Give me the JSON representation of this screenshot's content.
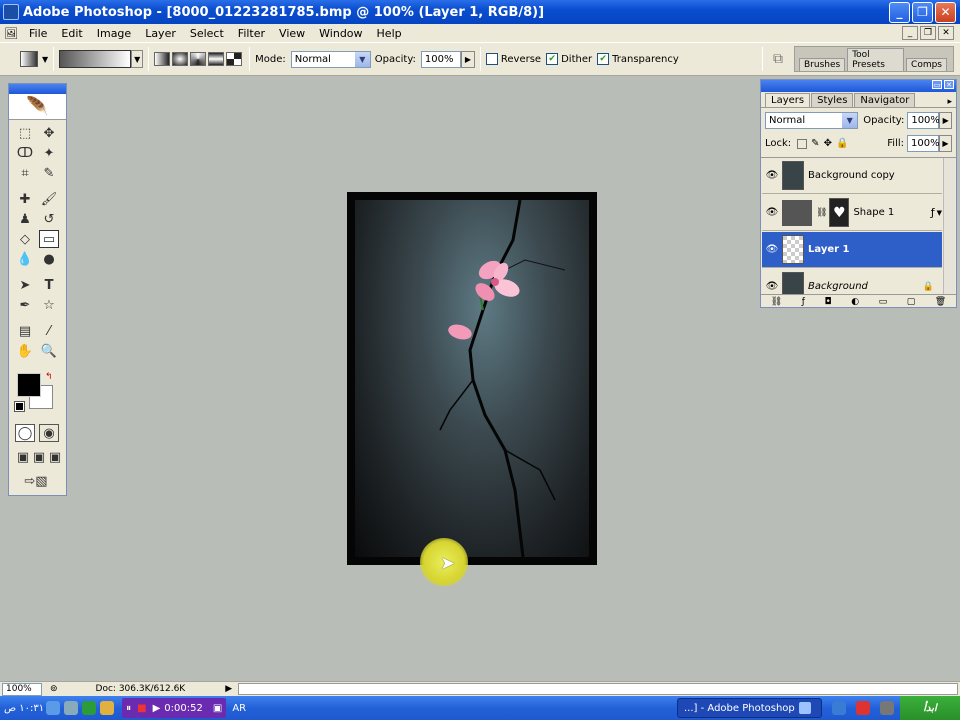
{
  "window": {
    "title": "Adobe Photoshop - [8000_01223281785.bmp @ 100% (Layer 1, RGB/8)]"
  },
  "menu": [
    "File",
    "Edit",
    "Image",
    "Layer",
    "Select",
    "Filter",
    "View",
    "Window",
    "Help"
  ],
  "options": {
    "mode_label": "Mode:",
    "mode_value": "Normal",
    "opacity_label": "Opacity:",
    "opacity_value": "100%",
    "reverse_label": "Reverse",
    "reverse_checked": false,
    "dither_label": "Dither",
    "dither_checked": true,
    "transparency_label": "Transparency",
    "transparency_checked": true
  },
  "well_tabs": [
    "Brushes",
    "Tool Presets",
    "Comps"
  ],
  "layers_panel": {
    "tabs": [
      "Layers",
      "Styles",
      "Navigator"
    ],
    "blend_mode": "Normal",
    "opacity_label": "Opacity:",
    "opacity_value": "100%",
    "lock_label": "Lock:",
    "fill_label": "Fill:",
    "fill_value": "100%",
    "layers": [
      {
        "name": "Background copy",
        "selected": false
      },
      {
        "name": "Shape 1",
        "selected": false
      },
      {
        "name": "Layer 1",
        "selected": true
      },
      {
        "name": "Background",
        "selected": false
      }
    ]
  },
  "status": {
    "zoom": "100%",
    "doc": "Doc: 306.3K/612.6K"
  },
  "taskbar": {
    "timer": "0:00:52",
    "app_task": "...] - Adobe Photoshop",
    "lang": "AR",
    "clock": "١٠:٣١ ص"
  },
  "colors": {
    "foreground": "#000000",
    "background": "#ffffff",
    "selection": "#2e5fc8"
  }
}
